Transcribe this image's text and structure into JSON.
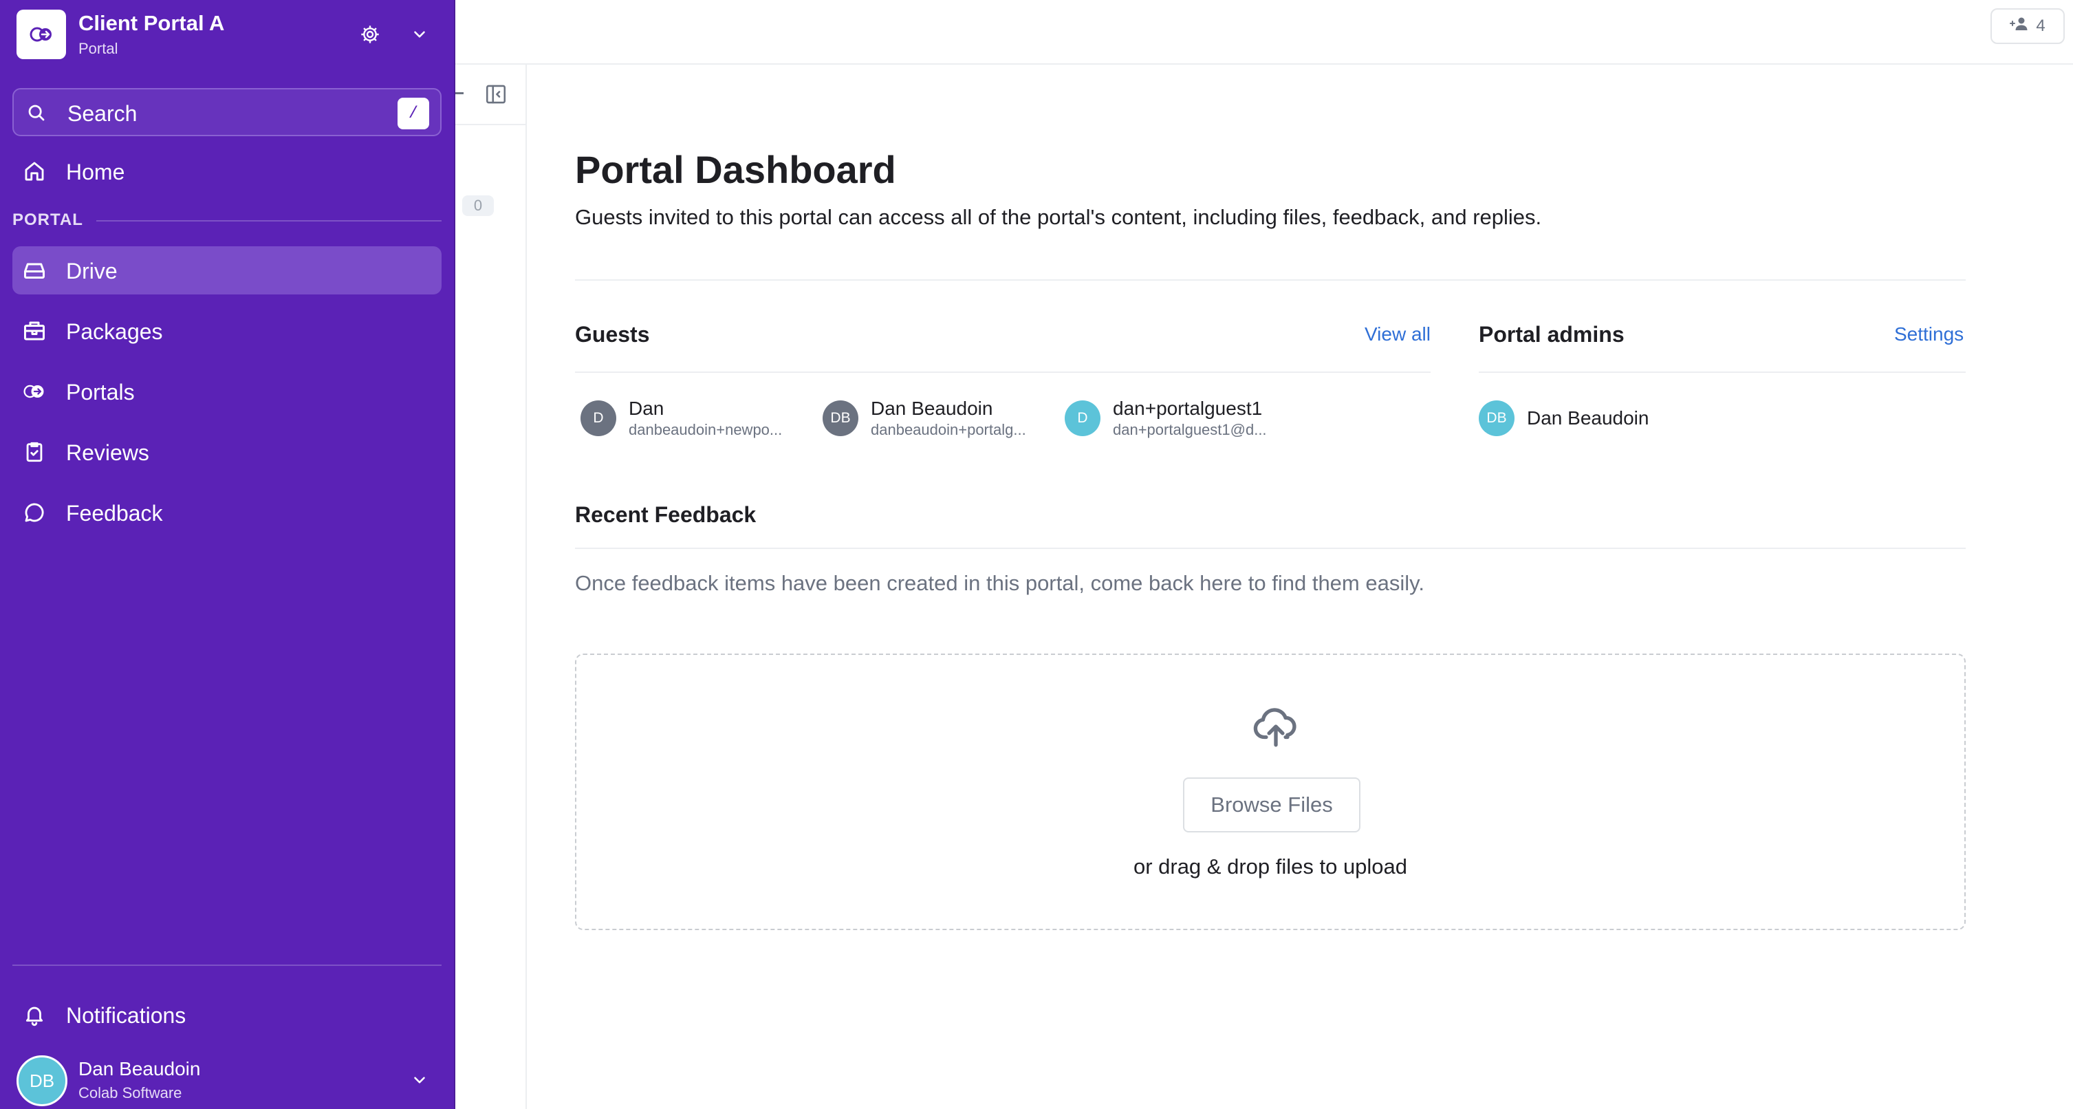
{
  "colors": {
    "sidebar_bg": "#5b22b6",
    "active_item": "#7a4cc9",
    "link": "#2f6fd6",
    "avatar_gray": "#6b7280",
    "avatar_teal": "#5cc3d9"
  },
  "workspace": {
    "name": "Client Portal A",
    "type": "Portal",
    "logo_icon": "portal-icon",
    "settings_icon": "gear-icon",
    "menu_icon": "chevron-down-icon"
  },
  "search": {
    "label": "Search",
    "shortcut": "/",
    "icon": "search-icon"
  },
  "nav": {
    "home": {
      "label": "Home",
      "icon": "home-icon"
    },
    "section_label": "PORTAL",
    "items": [
      {
        "label": "Drive",
        "icon": "drive-icon",
        "active": true
      },
      {
        "label": "Packages",
        "icon": "packages-icon",
        "active": false
      },
      {
        "label": "Portals",
        "icon": "portal-icon",
        "active": false
      },
      {
        "label": "Reviews",
        "icon": "clipboard-check-icon",
        "active": false
      },
      {
        "label": "Feedback",
        "icon": "comment-icon",
        "active": false
      }
    ],
    "notifications": {
      "label": "Notifications",
      "icon": "bell-icon"
    }
  },
  "user": {
    "initials": "DB",
    "name": "Dan Beaudoin",
    "org": "Colab Software"
  },
  "topbar": {
    "share_count": "4",
    "share_icon": "add-user-icon"
  },
  "middle": {
    "count": "0"
  },
  "dashboard": {
    "title": "Portal Dashboard",
    "description": "Guests invited to this portal can access all of the portal's content, including files, feedback, and replies.",
    "guests": {
      "title": "Guests",
      "view_all": "View all",
      "people": [
        {
          "initials": "D",
          "name": "Dan",
          "email": "danbeaudoin+newpo...",
          "color": "#6b7280"
        },
        {
          "initials": "DB",
          "name": "Dan Beaudoin",
          "email": "danbeaudoin+portalg...",
          "color": "#6b7280"
        },
        {
          "initials": "D",
          "name": "dan+portalguest1",
          "email": "dan+portalguest1@d...",
          "color": "#5cc3d9"
        }
      ]
    },
    "admins": {
      "title": "Portal admins",
      "settings": "Settings",
      "people": [
        {
          "initials": "DB",
          "name": "Dan Beaudoin",
          "color": "#5cc3d9"
        }
      ]
    },
    "feedback": {
      "title": "Recent Feedback",
      "empty": "Once feedback items have been created in this portal, come back here to find them easily."
    },
    "upload": {
      "icon": "cloud-upload-icon",
      "browse_label": "Browse Files",
      "hint": "or drag & drop files to upload"
    }
  }
}
